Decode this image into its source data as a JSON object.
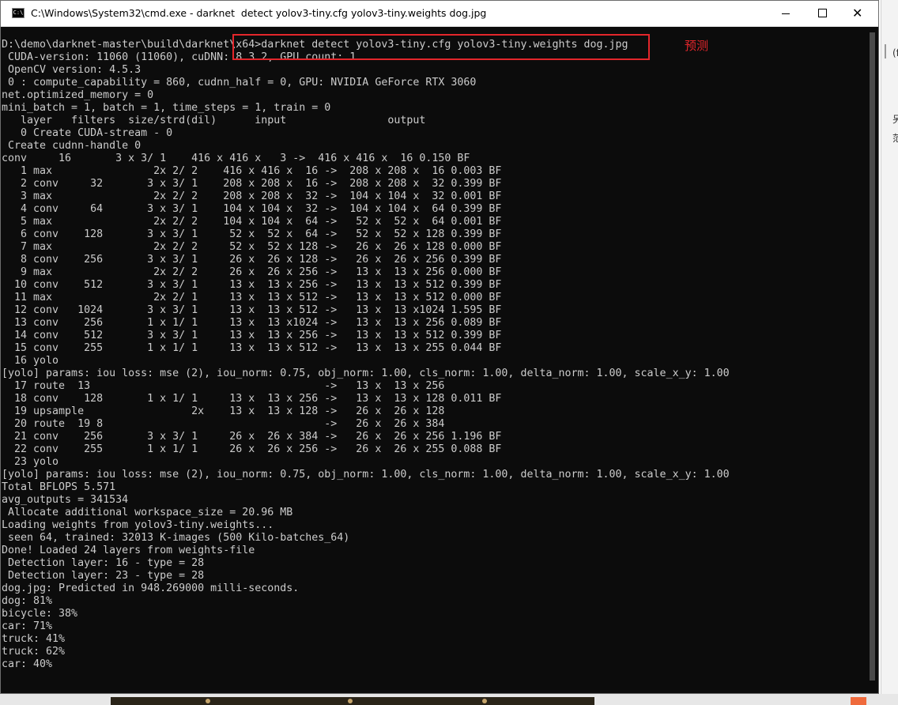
{
  "window": {
    "title": "C:\\Windows\\System32\\cmd.exe - darknet  detect yolov3-tiny.cfg yolov3-tiny.weights dog.jpg",
    "icon_label": "C:\\",
    "minimize_label": "—",
    "maximize_label": "□",
    "close_label": "✕"
  },
  "annotation": {
    "label": "预测",
    "color": "#e3262b"
  },
  "colors": {
    "console_bg": "#0c0c0c",
    "console_text": "#cccccc",
    "annotation_red": "#e3262b"
  },
  "background": {
    "right_glyphs": [
      "(f",
      "另",
      "范"
    ]
  },
  "console_lines": [
    "D:\\demo\\darknet-master\\build\\darknet\\x64>darknet detect yolov3-tiny.cfg yolov3-tiny.weights dog.jpg",
    " CUDA-version: 11060 (11060), cuDNN: 8.3.2, GPU count: 1",
    " OpenCV version: 4.5.3",
    " 0 : compute_capability = 860, cudnn_half = 0, GPU: NVIDIA GeForce RTX 3060",
    "net.optimized_memory = 0",
    "mini_batch = 1, batch = 1, time_steps = 1, train = 0",
    "   layer   filters  size/strd(dil)      input                output",
    "   0 Create CUDA-stream - 0",
    " Create cudnn-handle 0",
    "conv     16       3 x 3/ 1    416 x 416 x   3 ->  416 x 416 x  16 0.150 BF",
    "   1 max                2x 2/ 2    416 x 416 x  16 ->  208 x 208 x  16 0.003 BF",
    "   2 conv     32       3 x 3/ 1    208 x 208 x  16 ->  208 x 208 x  32 0.399 BF",
    "   3 max                2x 2/ 2    208 x 208 x  32 ->  104 x 104 x  32 0.001 BF",
    "   4 conv     64       3 x 3/ 1    104 x 104 x  32 ->  104 x 104 x  64 0.399 BF",
    "   5 max                2x 2/ 2    104 x 104 x  64 ->   52 x  52 x  64 0.001 BF",
    "   6 conv    128       3 x 3/ 1     52 x  52 x  64 ->   52 x  52 x 128 0.399 BF",
    "   7 max                2x 2/ 2     52 x  52 x 128 ->   26 x  26 x 128 0.000 BF",
    "   8 conv    256       3 x 3/ 1     26 x  26 x 128 ->   26 x  26 x 256 0.399 BF",
    "   9 max                2x 2/ 2     26 x  26 x 256 ->   13 x  13 x 256 0.000 BF",
    "  10 conv    512       3 x 3/ 1     13 x  13 x 256 ->   13 x  13 x 512 0.399 BF",
    "  11 max                2x 2/ 1     13 x  13 x 512 ->   13 x  13 x 512 0.000 BF",
    "  12 conv   1024       3 x 3/ 1     13 x  13 x 512 ->   13 x  13 x1024 1.595 BF",
    "  13 conv    256       1 x 1/ 1     13 x  13 x1024 ->   13 x  13 x 256 0.089 BF",
    "  14 conv    512       3 x 3/ 1     13 x  13 x 256 ->   13 x  13 x 512 0.399 BF",
    "  15 conv    255       1 x 1/ 1     13 x  13 x 512 ->   13 x  13 x 255 0.044 BF",
    "  16 yolo",
    "[yolo] params: iou loss: mse (2), iou_norm: 0.75, obj_norm: 1.00, cls_norm: 1.00, delta_norm: 1.00, scale_x_y: 1.00",
    "  17 route  13                                     ->   13 x  13 x 256",
    "  18 conv    128       1 x 1/ 1     13 x  13 x 256 ->   13 x  13 x 128 0.011 BF",
    "  19 upsample                 2x    13 x  13 x 128 ->   26 x  26 x 128",
    "  20 route  19 8                                   ->   26 x  26 x 384",
    "  21 conv    256       3 x 3/ 1     26 x  26 x 384 ->   26 x  26 x 256 1.196 BF",
    "  22 conv    255       1 x 1/ 1     26 x  26 x 256 ->   26 x  26 x 255 0.088 BF",
    "  23 yolo",
    "[yolo] params: iou loss: mse (2), iou_norm: 0.75, obj_norm: 1.00, cls_norm: 1.00, delta_norm: 1.00, scale_x_y: 1.00",
    "Total BFLOPS 5.571",
    "avg_outputs = 341534",
    " Allocate additional workspace_size = 20.96 MB",
    "Loading weights from yolov3-tiny.weights...",
    " seen 64, trained: 32013 K-images (500 Kilo-batches_64)",
    "Done! Loaded 24 layers from weights-file",
    " Detection layer: 16 - type = 28",
    " Detection layer: 23 - type = 28",
    "dog.jpg: Predicted in 948.269000 milli-seconds.",
    "dog: 81%",
    "bicycle: 38%",
    "car: 71%",
    "truck: 41%",
    "truck: 62%",
    "car: 40%"
  ]
}
